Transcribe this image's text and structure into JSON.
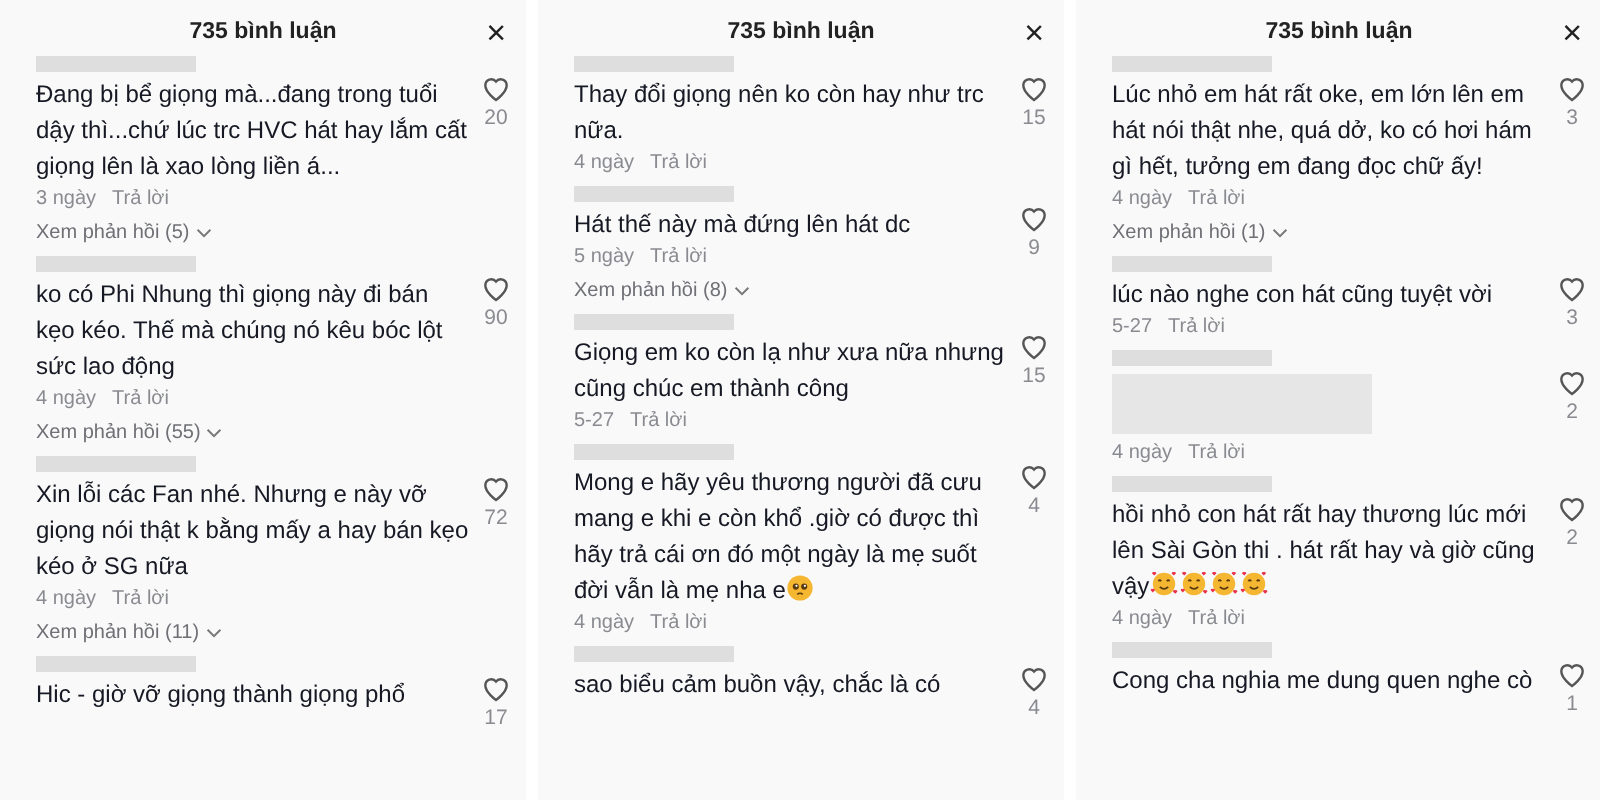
{
  "panels": [
    {
      "title": "735 bình luận",
      "close": "×",
      "comments": [
        {
          "kind": "text",
          "text": "Đang bị bể giọng mà...đang trong tuổi dậy thì...chứ lúc trc HVC hát hay lắm cất giọng lên là xao lòng liền á...",
          "likes": "20",
          "date": "3 ngày",
          "reply": "Trả lời",
          "replies": "Xem phản hồi (5)"
        },
        {
          "kind": "text",
          "text": "ko có Phi Nhung thì giọng này đi bán kẹo kéo. Thế mà chúng nó kêu bóc lột sức lao động",
          "likes": "90",
          "date": "4 ngày",
          "reply": "Trả lời",
          "replies": "Xem phản hồi (55)"
        },
        {
          "kind": "text",
          "text": "Xin lỗi các Fan nhé. Nhưng e này vỡ giọng nói thật k bằng mấy a hay bán kẹo kéo ở SG nữa",
          "likes": "72",
          "date": "4 ngày",
          "reply": "Trả lời",
          "replies": "Xem phản hồi (11)"
        },
        {
          "kind": "text",
          "text": "Hic - giờ vỡ giọng thành giọng phổ",
          "likes": "17"
        }
      ]
    },
    {
      "title": "735 bình luận",
      "close": "×",
      "comments": [
        {
          "kind": "text",
          "text": "Thay đổi giọng nên ko còn hay như trc nữa.",
          "likes": "15",
          "date": "4 ngày",
          "reply": "Trả lời"
        },
        {
          "kind": "text",
          "text": "Hát thế này mà đứng lên hát dc",
          "likes": "9",
          "date": "5 ngày",
          "reply": "Trả lời",
          "replies": "Xem phản hồi (8)"
        },
        {
          "kind": "text",
          "text": "Giọng em ko còn lạ như xưa nữa nhưng cũng chúc em thành công",
          "likes": "15",
          "date": "5-27",
          "reply": "Trả lời"
        },
        {
          "kind": "text",
          "text": "Mong e hãy yêu thương người đã cưu mang e khi e còn khổ .giờ có được thì hãy trả cái ơn đó một ngày là mẹ suốt đời vẫn là mẹ nha e",
          "emojis": [
            {
              "kind": "pleading"
            }
          ],
          "likes": "4",
          "date": "4 ngày",
          "reply": "Trả lời"
        },
        {
          "kind": "text",
          "text": "sao biểu cảm buồn vậy, chắc là có",
          "likes": "4"
        }
      ]
    },
    {
      "title": "735 bình luận",
      "close": "×",
      "comments": [
        {
          "kind": "text",
          "text": "Lúc nhỏ em hát rất oke, em lớn lên em hát nói thật nhe, quá dở, ko có hơi hám gì hết, tưởng em đang đọc chữ ấy!",
          "likes": "3",
          "date": "4 ngày",
          "reply": "Trả lời",
          "replies": "Xem phản hồi (1)"
        },
        {
          "kind": "text",
          "text": "lúc nào nghe con hát cũng tuyệt vời",
          "likes": "3",
          "date": "5-27",
          "reply": "Trả lời"
        },
        {
          "kind": "blurred",
          "likes": "2",
          "date": "4 ngày",
          "reply": "Trả lời"
        },
        {
          "kind": "text",
          "text": "hồi nhỏ con hát rất hay thương lúc mới lên Sài Gòn thi . hát rất hay và giờ cũng vậy",
          "emojis": [
            {
              "kind": "hearts"
            },
            {
              "kind": "hearts"
            },
            {
              "kind": "hearts"
            },
            {
              "kind": "hearts"
            }
          ],
          "likes": "2",
          "date": "4 ngày",
          "reply": "Trả lời"
        },
        {
          "kind": "text",
          "text": "Cong cha nghia me dung quen nghe cò",
          "likes": "1"
        }
      ]
    }
  ]
}
